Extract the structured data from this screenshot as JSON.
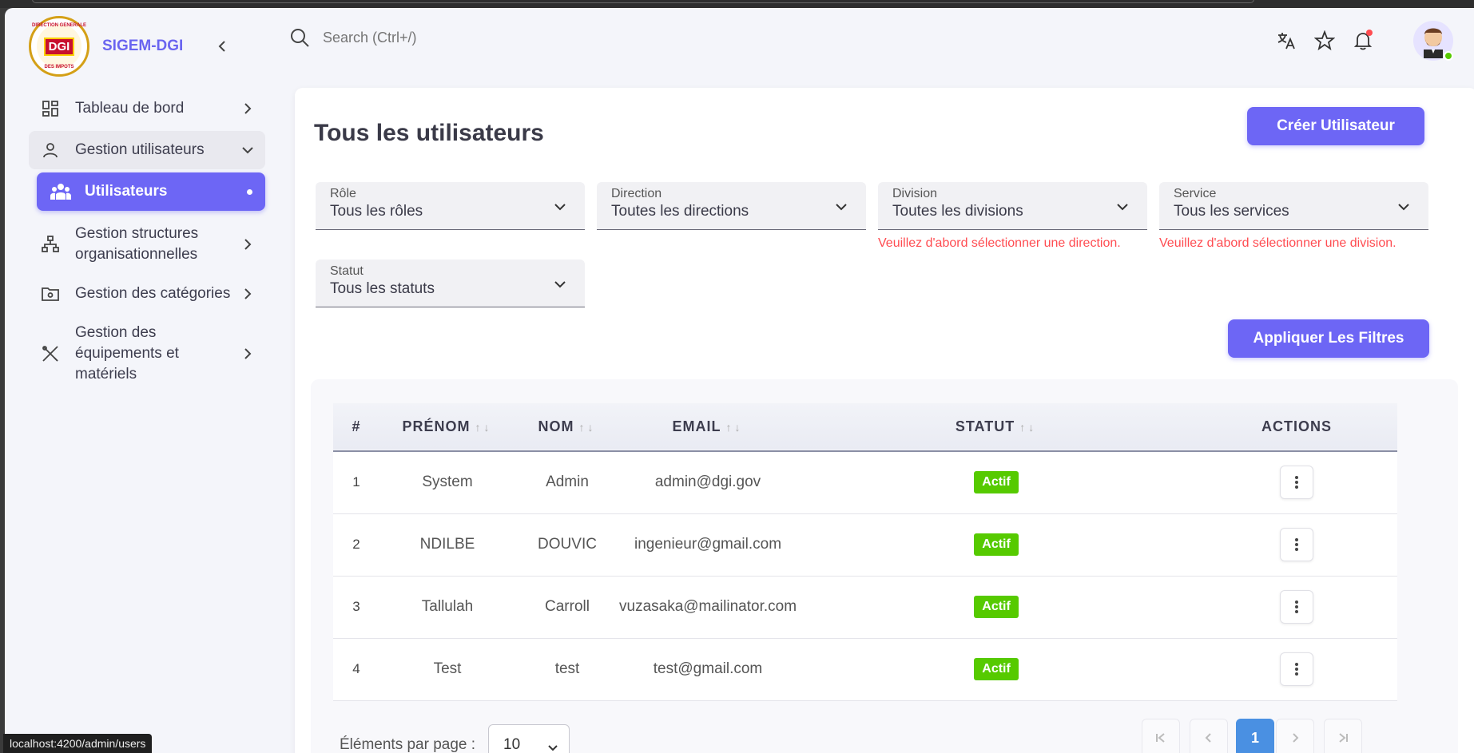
{
  "app": {
    "name": "SIGEM-DGI",
    "logo_text": "DGI",
    "logo_ring_top": "DIRECTION GENERALE",
    "logo_ring_bottom": "DES IMPOTS"
  },
  "header": {
    "search_placeholder": "Search (Ctrl+/)"
  },
  "sidebar": {
    "items": [
      {
        "label": "Tableau de bord"
      },
      {
        "label": "Gestion utilisateurs"
      },
      {
        "label": "Utilisateurs"
      },
      {
        "label": "Gestion structures organisationnelles"
      },
      {
        "label": "Gestion des catégories"
      },
      {
        "label": "Gestion des équipements et matériels"
      }
    ]
  },
  "page": {
    "title": "Tous les utilisateurs",
    "create_button": "Créer Utilisateur",
    "apply_button": "Appliquer Les Filtres"
  },
  "filters": {
    "role": {
      "label": "Rôle",
      "value": "Tous les rôles"
    },
    "direction": {
      "label": "Direction",
      "value": "Toutes les directions"
    },
    "division": {
      "label": "Division",
      "value": "Toutes les divisions",
      "error": "Veuillez d'abord sélectionner une direction."
    },
    "service": {
      "label": "Service",
      "value": "Tous les services",
      "error": "Veuillez d'abord sélectionner une division."
    },
    "statut": {
      "label": "Statut",
      "value": "Tous les statuts"
    }
  },
  "table": {
    "headers": {
      "num": "#",
      "prenom": "PRÉNOM",
      "nom": "NOM",
      "email": "EMAIL",
      "statut": "STATUT",
      "actions": "ACTIONS"
    },
    "rows": [
      {
        "num": "1",
        "prenom": "System",
        "nom": "Admin",
        "email": "admin@dgi.gov",
        "statut": "Actif"
      },
      {
        "num": "2",
        "prenom": "NDILBE",
        "nom": "DOUVIC",
        "email": "ingenieur@gmail.com",
        "statut": "Actif"
      },
      {
        "num": "3",
        "prenom": "Tallulah",
        "nom": "Carroll",
        "email": "vuzasaka@mailinator.com",
        "statut": "Actif"
      },
      {
        "num": "4",
        "prenom": "Test",
        "nom": "test",
        "email": "test@gmail.com",
        "statut": "Actif"
      }
    ]
  },
  "pagination": {
    "label": "Éléments par page :",
    "page_size": "10",
    "current_page": "1"
  },
  "status_bar": {
    "url": "localhost:4200/admin/users"
  },
  "colors": {
    "primary": "#6d66f5",
    "success": "#56ca00",
    "error": "#ff4c51",
    "page_active": "#4a90e2"
  }
}
